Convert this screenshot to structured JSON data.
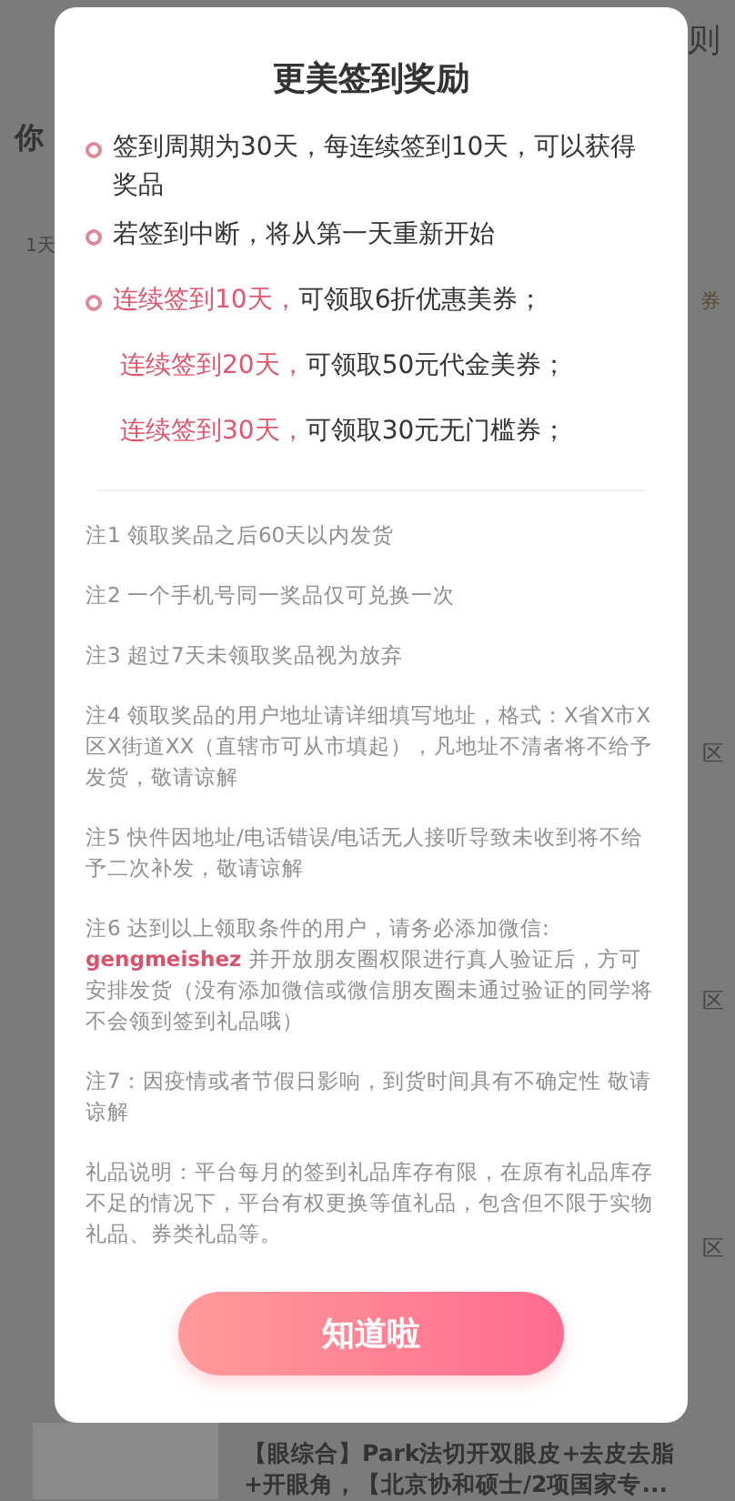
{
  "background": {
    "header_text": "则",
    "greeting": "你",
    "day_label": "1天",
    "coupon_label": "券",
    "area_labels": [
      "区",
      "区",
      "区"
    ],
    "product_lines": [
      "【眼综合】Park法切开双眼皮+去皮去脂",
      "+开眼角，【北京协和硕士/2项国家专..."
    ]
  },
  "dialog": {
    "title": "更美签到奖励",
    "rules": [
      {
        "bullet": true,
        "text": "签到周期为30天，每连续签到10天，可以获得奖品"
      },
      {
        "bullet": true,
        "text": "若签到中断，将从第一天重新开始"
      },
      {
        "bullet": true,
        "highlight": "连续签到10天，",
        "text": "可领取6折优惠美券；"
      },
      {
        "bullet": false,
        "highlight": "连续签到20天，",
        "text": "可领取50元代金美券；"
      },
      {
        "bullet": false,
        "highlight": "连续签到30天，",
        "text": "可领取30元无门槛券；"
      }
    ],
    "notes": [
      {
        "text": "注1 领取奖品之后60天以内发货"
      },
      {
        "text": "注2 一个手机号同一奖品仅可兑换一次"
      },
      {
        "text": "注3 超过7天未领取奖品视为放弃"
      },
      {
        "text": "注4 领取奖品的用户地址请详细填写地址，格式：X省X市X区X街道XX（直辖市可从市填起），凡地址不清者将不给予发货，敬请谅解"
      },
      {
        "text": "注5 快件因地址/电话错误/电话无人接听导致未收到将不给予二次补发，敬请谅解"
      },
      {
        "text": "注6 达到以上领取条件的用户，请务必添加微信: **gengmeishez** 并开放朋友圈权限进行真人验证后，方可安排发货（没有添加微信或微信朋友圈未通过验证的同学将不会领到签到礼品哦）"
      },
      {
        "text": "注7：因疫情或者节假日影响，到货时间具有不确定性 敬请谅解"
      },
      {
        "text": "礼品说明：平台每月的签到礼品库存有限，在原有礼品库存不足的情况下，平台有权更换等值礼品，包含但不限于实物礼品、券类礼品等。"
      }
    ],
    "button": "知道啦"
  }
}
